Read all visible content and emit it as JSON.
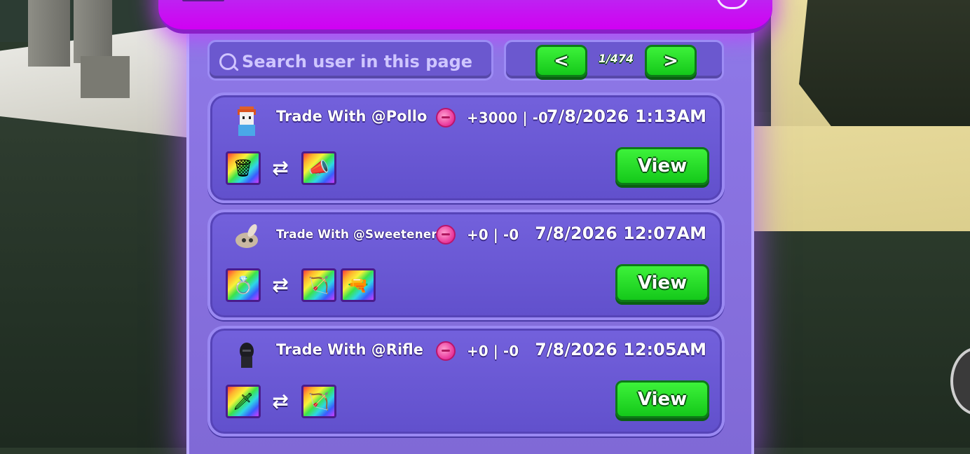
{
  "search": {
    "placeholder": "Search user in this page"
  },
  "pager": {
    "prev_label": "<",
    "next_label": ">",
    "page_indicator": "1/474"
  },
  "trades": [
    {
      "title": "Trade With @Pollo",
      "gain": "+3000 | -0",
      "date": "7/8/2026 1:13AM",
      "view_label": "View",
      "avatar": "avatar-red-hair",
      "give_items": [
        "trash-can-icon"
      ],
      "get_items": [
        "megaphone-icon"
      ]
    },
    {
      "title": "Trade With @Sweetener",
      "gain": "+0 | -0",
      "date": "7/8/2026 12:07AM",
      "view_label": "View",
      "avatar": "avatar-bunny",
      "give_items": [
        "ring-icon"
      ],
      "get_items": [
        "bow-icon",
        "blaster-icon"
      ]
    },
    {
      "title": "Trade With @Rifle",
      "gain": "+0 | -0",
      "date": "7/8/2026 12:05AM",
      "view_label": "View",
      "avatar": "avatar-dark-helmet",
      "give_items": [
        "sword-icon"
      ],
      "get_items": [
        "bow-icon"
      ]
    }
  ],
  "colors": {
    "panel": "#8069d6",
    "header": "#d100f3",
    "card": "#6150cc",
    "button_green": "#14c81a",
    "coin_pink": "#e8349a"
  }
}
